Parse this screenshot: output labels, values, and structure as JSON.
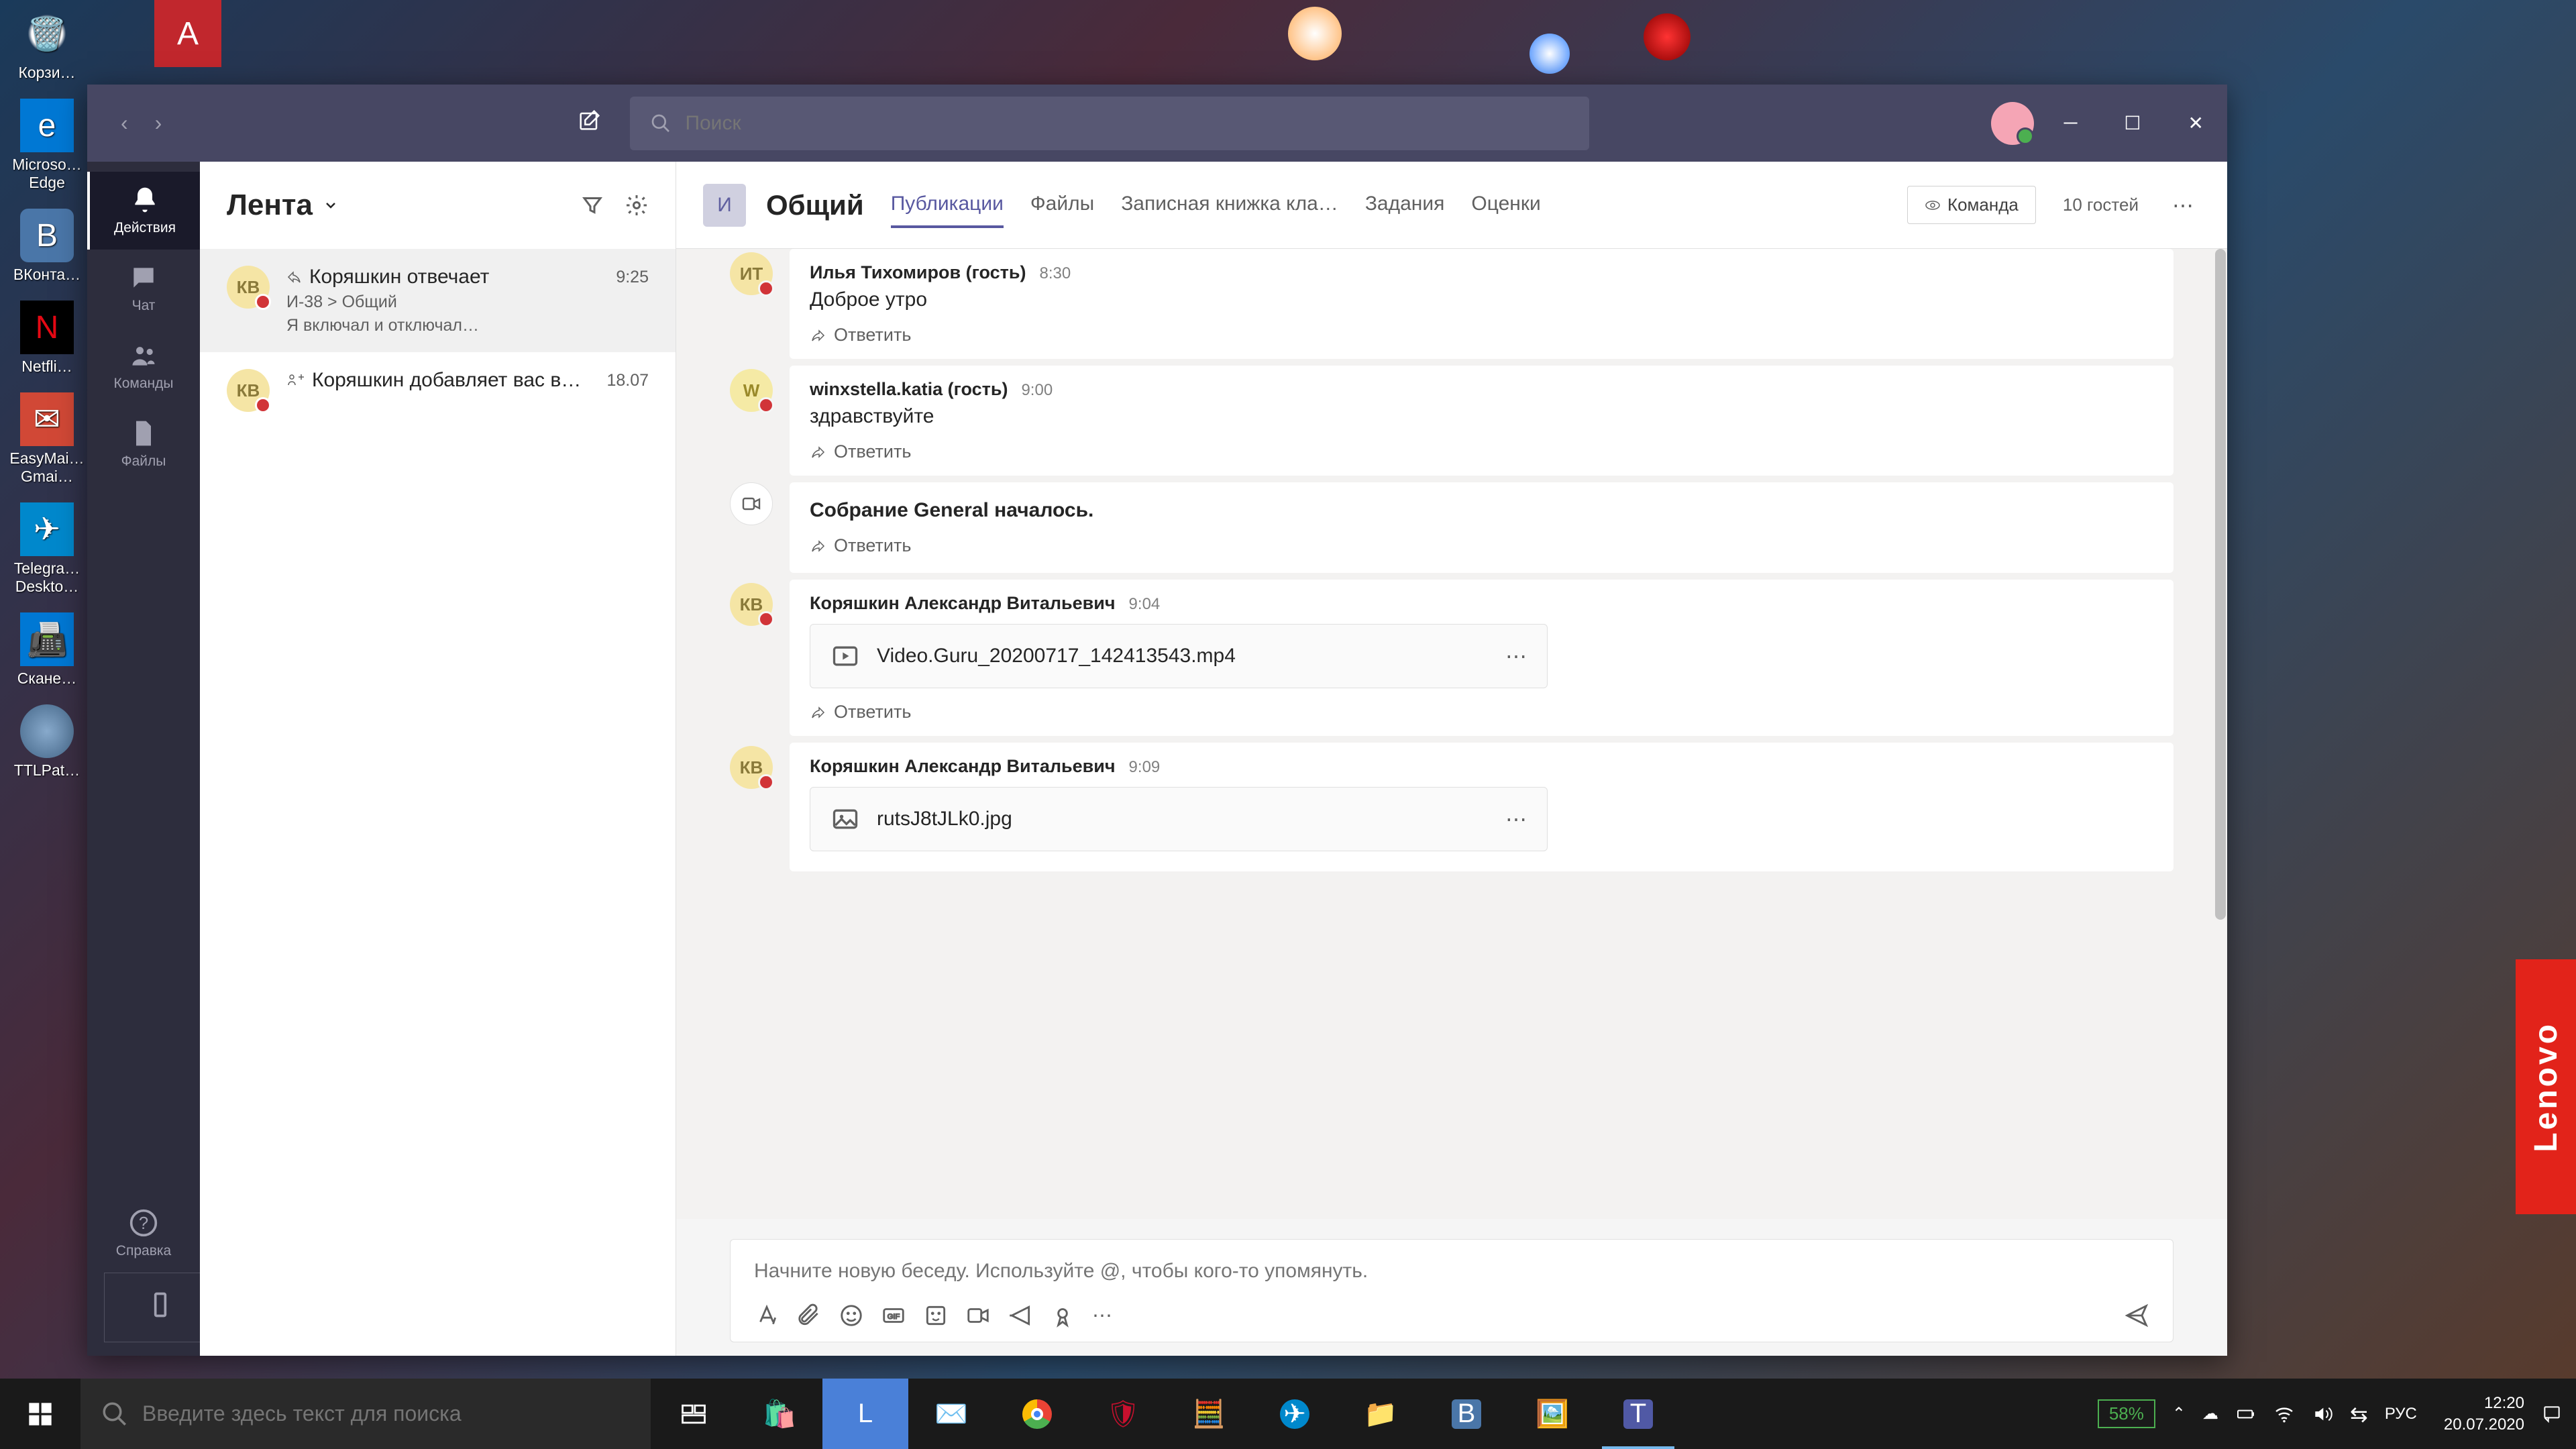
{
  "desktop": {
    "recycle": "Корзи…",
    "edge": "Microso…\nEdge",
    "vk": "ВКонта…",
    "netflix": "Netfli…",
    "gmail": "EasyMai…\nGmai…",
    "telegram": "Telegra…\nDeskto…",
    "scanner": "Скане…",
    "ttl": "TTLPat…"
  },
  "teams": {
    "search_placeholder": "Поиск",
    "rail": {
      "activity": "Действия",
      "chat": "Чат",
      "teams": "Команды",
      "files": "Файлы",
      "help": "Справка"
    },
    "feed_title": "Лента",
    "feed": [
      {
        "initials": "КВ",
        "title": "Коряшкин отвечает",
        "time": "9:25",
        "channel": "И-38 > Общий",
        "preview": "Я включал и отключал…"
      },
      {
        "initials": "КВ",
        "title": "Коряшкин добавляет вас в…",
        "time": "18.07"
      }
    ],
    "channel": {
      "team_initial": "И",
      "name": "Общий",
      "tabs": {
        "posts": "Публикации",
        "files": "Файлы",
        "notebook": "Записная книжка кла…",
        "assignments": "Задания",
        "grades": "Оценки"
      },
      "team_btn": "Команда",
      "guests": "10 гостей"
    },
    "messages": [
      {
        "type": "user",
        "initials": "ИТ",
        "author": "Илья Тихомиров (гость)",
        "time": "8:30",
        "text": "Доброе утро"
      },
      {
        "type": "user",
        "initials": "W",
        "author": "winxstella.katia (гость)",
        "time": "9:00",
        "text": "здравствуйте"
      },
      {
        "type": "system",
        "text": "Собрание General началось."
      },
      {
        "type": "file",
        "initials": "КВ",
        "author": "Коряшкин Александр Витальевич",
        "time": "9:04",
        "file": "Video.Guru_20200717_142413543.mp4",
        "kind": "video"
      },
      {
        "type": "file",
        "initials": "КВ",
        "author": "Коряшкин Александр Витальевич",
        "time": "9:09",
        "file": "rutsJ8tJLk0.jpg",
        "kind": "image"
      }
    ],
    "reply_label": "Ответить",
    "compose_placeholder": "Начните новую беседу. Используйте @, чтобы кого-то упомянуть."
  },
  "taskbar": {
    "search_placeholder": "Введите здесь текст для поиска",
    "battery": "58%",
    "lang": "РУС",
    "time": "12:20",
    "date": "20.07.2020"
  },
  "lenovo": "Lenovo"
}
